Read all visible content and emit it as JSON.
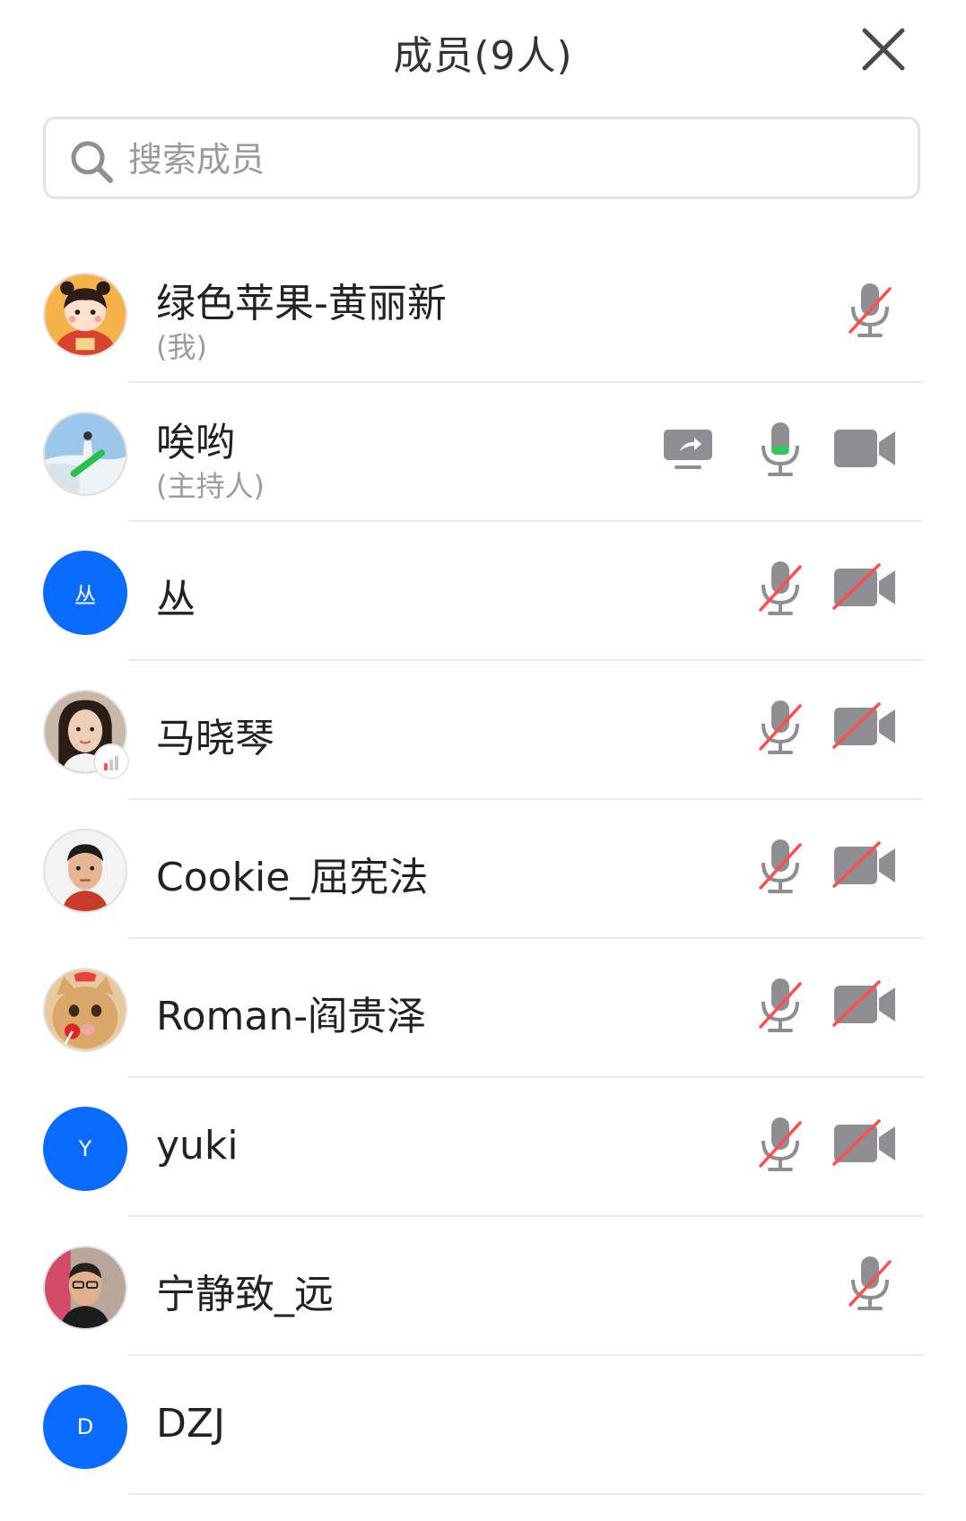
{
  "header": {
    "title": "成员(9人)"
  },
  "search": {
    "placeholder": "搜索成员"
  },
  "colors": {
    "accent": "#0a6cff",
    "icon_gray": "#8e8e93",
    "mute_red": "#ff4d4f",
    "active_green": "#34c759"
  },
  "members": [
    {
      "name": "绿色苹果-黄丽新",
      "role": "(我)",
      "avatar": "cartoon-girl-avatar",
      "mic": "muted",
      "camera": "none",
      "sharing": false
    },
    {
      "name": "唉哟",
      "role": "(主持人)",
      "avatar": "snowboarder-avatar",
      "mic": "active",
      "camera": "on",
      "sharing": true
    },
    {
      "name": "丛",
      "role": "",
      "avatar_letter": "丛",
      "mic": "muted",
      "camera": "off",
      "sharing": false
    },
    {
      "name": "马晓琴",
      "role": "",
      "avatar": "woman-portrait-avatar",
      "mic": "muted",
      "camera": "off",
      "sharing": false
    },
    {
      "name": "Cookie_屈宪法",
      "role": "",
      "avatar": "man-portrait-avatar",
      "mic": "muted",
      "camera": "off",
      "sharing": false
    },
    {
      "name": "Roman-阎贵泽",
      "role": "",
      "avatar": "cat-avatar",
      "mic": "muted",
      "camera": "off",
      "sharing": false
    },
    {
      "name": "yuki",
      "role": "",
      "avatar_letter": "Y",
      "mic": "muted",
      "camera": "off",
      "sharing": false
    },
    {
      "name": "宁静致_远",
      "role": "",
      "avatar": "man-photo-avatar",
      "mic": "muted",
      "camera": "none",
      "sharing": false
    },
    {
      "name": "DZJ",
      "role": "",
      "avatar_letter": "D",
      "mic": "none",
      "camera": "none",
      "sharing": false
    }
  ]
}
